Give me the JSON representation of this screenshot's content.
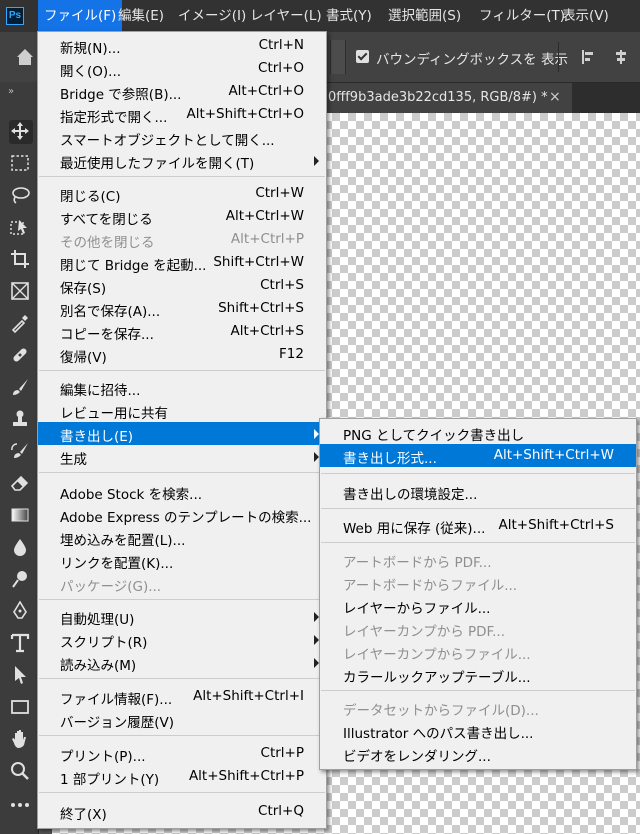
{
  "menubar": {
    "logo": "Ps",
    "items": [
      {
        "label": "ファイル(F)",
        "active": true
      },
      {
        "label": "編集(E)"
      },
      {
        "label": "イメージ(I)"
      },
      {
        "label": "レイヤー(L)"
      },
      {
        "label": "書式(Y)"
      },
      {
        "label": "選択範囲(S)"
      },
      {
        "label": "フィルター(T)"
      },
      {
        "label": "表示(V)"
      }
    ]
  },
  "optionsbar": {
    "bounding_box_label": "バウンディングボックスを 表示",
    "bounding_box_checked": true
  },
  "document_tab": {
    "label": "0fff9b3ade3b22cd135, RGB/8#) *",
    "close": "×"
  },
  "toolbar": {
    "grip": "»",
    "tools": [
      "move-tool-icon",
      "marquee-tool-icon",
      "lasso-tool-icon",
      "object-select-tool-icon",
      "crop-tool-icon",
      "frame-tool-icon",
      "eyedropper-tool-icon",
      "healing-brush-tool-icon",
      "brush-tool-icon",
      "clone-stamp-tool-icon",
      "history-brush-tool-icon",
      "eraser-tool-icon",
      "gradient-tool-icon",
      "blur-tool-icon",
      "dodge-tool-icon",
      "pen-tool-icon",
      "type-tool-icon",
      "path-select-tool-icon",
      "rectangle-tool-icon",
      "hand-tool-icon",
      "zoom-tool-icon",
      "more-tools-icon"
    ]
  },
  "file_menu": {
    "groups": [
      [
        {
          "label": "新規(N)...",
          "shortcut": "Ctrl+N"
        },
        {
          "label": "開く(O)...",
          "shortcut": "Ctrl+O"
        },
        {
          "label": "Bridge で参照(B)...",
          "shortcut": "Alt+Ctrl+O"
        },
        {
          "label": "指定形式で開く...",
          "shortcut": "Alt+Shift+Ctrl+O"
        },
        {
          "label": "スマートオブジェクトとして開く..."
        },
        {
          "label": "最近使用したファイルを開く(T)",
          "submenu": true
        }
      ],
      [
        {
          "label": "閉じる(C)",
          "shortcut": "Ctrl+W"
        },
        {
          "label": "すべてを閉じる",
          "shortcut": "Alt+Ctrl+W"
        },
        {
          "label": "その他を閉じる",
          "shortcut": "Alt+Ctrl+P",
          "disabled": true
        },
        {
          "label": "閉じて Bridge を起動...",
          "shortcut": "Shift+Ctrl+W"
        },
        {
          "label": "保存(S)",
          "shortcut": "Ctrl+S"
        },
        {
          "label": "別名で保存(A)...",
          "shortcut": "Shift+Ctrl+S"
        },
        {
          "label": "コピーを保存...",
          "shortcut": "Alt+Ctrl+S"
        },
        {
          "label": "復帰(V)",
          "shortcut": "F12"
        }
      ],
      [
        {
          "label": "編集に招待..."
        },
        {
          "label": "レビュー用に共有"
        },
        {
          "label": "書き出し(E)",
          "submenu": true,
          "highlighted": true
        },
        {
          "label": "生成",
          "submenu": true
        }
      ],
      [
        {
          "label": "Adobe Stock を検索..."
        },
        {
          "label": "Adobe Express のテンプレートの検索..."
        },
        {
          "label": "埋め込みを配置(L)..."
        },
        {
          "label": "リンクを配置(K)..."
        },
        {
          "label": "パッケージ(G)...",
          "disabled": true
        }
      ],
      [
        {
          "label": "自動処理(U)",
          "submenu": true
        },
        {
          "label": "スクリプト(R)",
          "submenu": true
        },
        {
          "label": "読み込み(M)",
          "submenu": true
        }
      ],
      [
        {
          "label": "ファイル情報(F)...",
          "shortcut": "Alt+Shift+Ctrl+I"
        },
        {
          "label": "バージョン履歴(V)"
        }
      ],
      [
        {
          "label": "プリント(P)...",
          "shortcut": "Ctrl+P"
        },
        {
          "label": "1 部プリント(Y)",
          "shortcut": "Alt+Shift+Ctrl+P"
        }
      ],
      [
        {
          "label": "終了(X)",
          "shortcut": "Ctrl+Q"
        }
      ]
    ]
  },
  "export_submenu": {
    "groups": [
      [
        {
          "label": "PNG としてクイック書き出し"
        },
        {
          "label": "書き出し形式...",
          "shortcut": "Alt+Shift+Ctrl+W",
          "highlighted": true
        }
      ],
      [
        {
          "label": "書き出しの環境設定..."
        }
      ],
      [
        {
          "label": "Web 用に保存 (従来)...",
          "shortcut": "Alt+Shift+Ctrl+S"
        }
      ],
      [
        {
          "label": "アートボードから PDF...",
          "disabled": true
        },
        {
          "label": "アートボードからファイル...",
          "disabled": true
        },
        {
          "label": "レイヤーからファイル..."
        },
        {
          "label": "レイヤーカンプから PDF...",
          "disabled": true
        },
        {
          "label": "レイヤーカンプからファイル...",
          "disabled": true
        },
        {
          "label": "カラールックアップテーブル..."
        }
      ],
      [
        {
          "label": "データセットからファイル(D)...",
          "disabled": true
        },
        {
          "label": "Illustrator へのパス書き出し..."
        },
        {
          "label": "ビデオをレンダリング..."
        }
      ]
    ]
  },
  "colors": {
    "menu_highlight": "#0078d7",
    "menubar_active": "#1473e6",
    "menu_bg": "#f0f0f0",
    "disabled_text": "#8f8f8f"
  }
}
